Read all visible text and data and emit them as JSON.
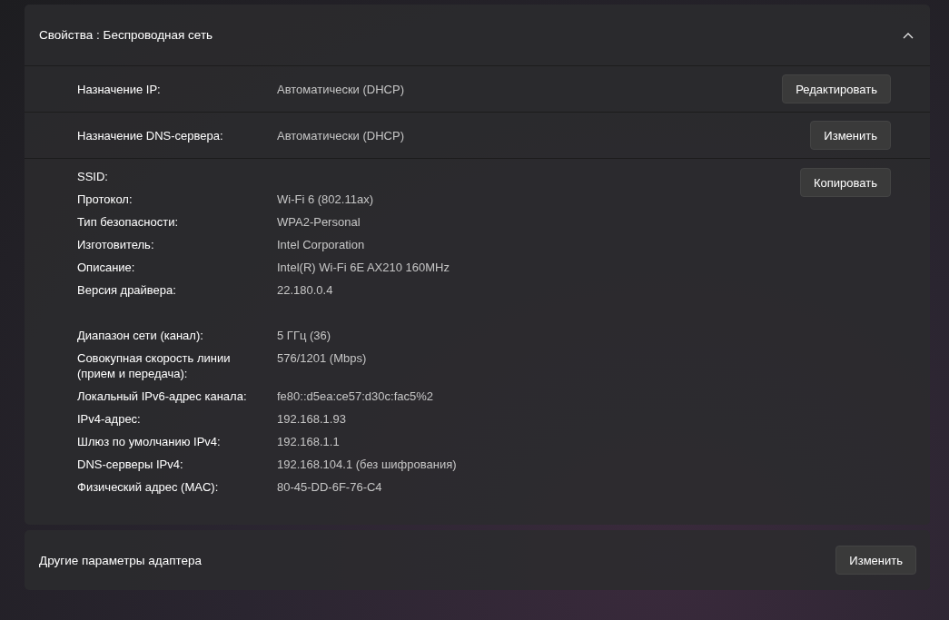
{
  "properties_panel": {
    "title": "Свойства : Беспроводная сеть",
    "expanded": true,
    "settings": [
      {
        "label": "Назначение IP:",
        "value": "Автоматически (DHCP)",
        "button": "Редактировать"
      },
      {
        "label": "Назначение DNS-сервера:",
        "value": "Автоматически (DHCP)",
        "button": "Изменить"
      }
    ],
    "copy_button": "Копировать",
    "detail_groups": [
      [
        {
          "label": "SSID:"
        },
        {
          "label": "Протокол:",
          "value": "Wi-Fi 6 (802.11ax)"
        },
        {
          "label": "Тип безопасности:",
          "value": "WPA2-Personal"
        },
        {
          "label": "Изготовитель:",
          "value": "Intel Corporation"
        },
        {
          "label": "Описание:",
          "value": "Intel(R) Wi-Fi 6E AX210 160MHz"
        },
        {
          "label": "Версия драйвера:",
          "value": "22.180.0.4"
        }
      ],
      [
        {
          "label": "Диапазон сети (канал):",
          "value": "5 ГГц (36)"
        },
        {
          "label": "Совокупная скорость линии (прием и передача):",
          "value": "576/1201 (Mbps)"
        },
        {
          "label": "Локальный IPv6-адрес канала:",
          "value": "fe80::d5ea:ce57:d30c:fac5%2"
        },
        {
          "label": "IPv4-адрес:",
          "value": "192.168.1.93"
        },
        {
          "label": "Шлюз по умолчанию IPv4:",
          "value": "192.168.1.1"
        },
        {
          "label": "DNS-серверы IPv4:",
          "value": "192.168.104.1 (без шифрования)"
        },
        {
          "label": "Физический адрес (MAC):",
          "value": "80-45-DD-6F-76-C4"
        }
      ]
    ]
  },
  "adapter_card": {
    "title": "Другие параметры адаптера",
    "button": "Изменить"
  }
}
